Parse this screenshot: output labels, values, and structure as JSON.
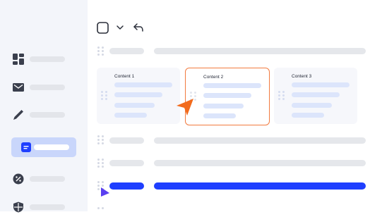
{
  "cards": [
    {
      "title": "Content 1"
    },
    {
      "title": "Content 2"
    },
    {
      "title": "Content 3"
    }
  ],
  "colors": {
    "accent_blue": "#1f3fff",
    "cursor_orange": "#f26b1d",
    "cursor_purple": "#5a3ff0",
    "selection_border": "#f27a3e",
    "sidebar_bg": "#f3f5fa",
    "active_nav_bg": "#c9d6fb"
  },
  "sidebar": {
    "items": [
      {
        "icon": "dashboard-icon",
        "active": false
      },
      {
        "icon": "mail-icon",
        "active": false
      },
      {
        "icon": "pen-icon",
        "active": false
      },
      {
        "icon": "document-icon",
        "active": true
      },
      {
        "icon": "discount-badge-icon",
        "active": false
      },
      {
        "icon": "shield-icon",
        "active": false
      }
    ]
  },
  "toolbar": {
    "icons": [
      "checkbox-icon",
      "chevron-down-icon",
      "reply-icon"
    ]
  }
}
